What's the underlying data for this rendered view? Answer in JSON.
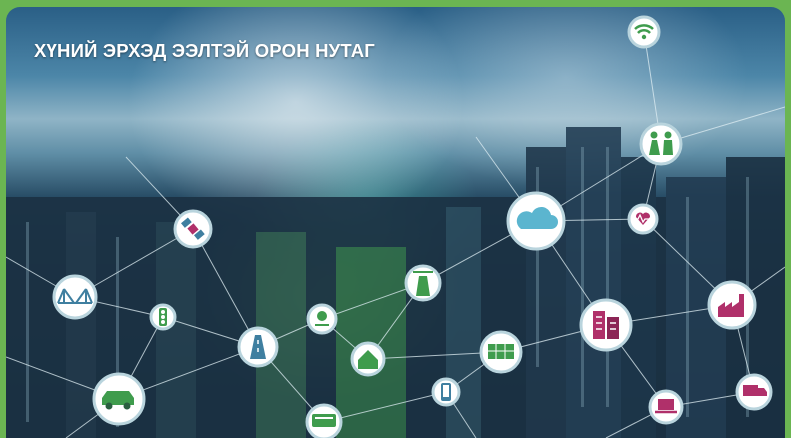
{
  "banner": {
    "title": "ХҮНИЙ ЭРХЭД ЭЭЛТЭЙ ОРОН НУТАГ"
  },
  "icons": [
    "wifi-icon",
    "people-icon",
    "cloud-icon",
    "heart-rate-icon",
    "factory-icon",
    "satellite-icon",
    "bridge-icon",
    "traffic-light-icon",
    "road-icon",
    "network-hub-icon",
    "house-icon",
    "solar-panel-icon",
    "buildings-icon",
    "car-icon",
    "smartphone-icon",
    "laptop-icon",
    "truck-icon",
    "bus-icon",
    "tower-icon"
  ],
  "colors": {
    "frame_green": "#6bb552",
    "accent_magenta": "#b0306a",
    "accent_green": "#3f9c4d"
  }
}
